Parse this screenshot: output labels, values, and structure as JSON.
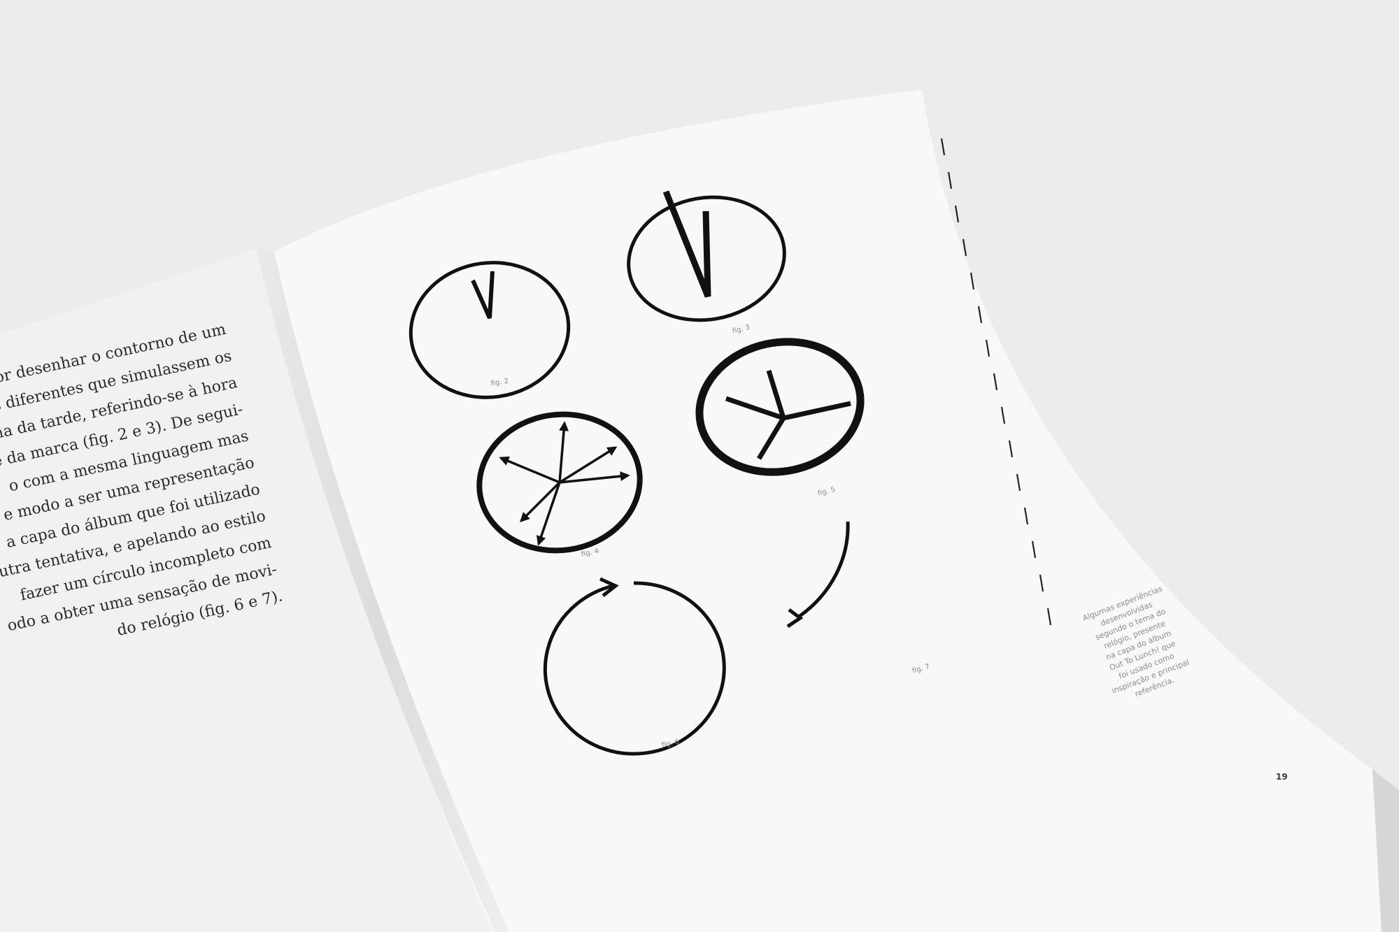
{
  "body_text": {
    "lines": [
      "or desenhar o contorno de um",
      "s diferentes que simulassem os",
      "ma da tarde, referindo-se à hora",
      "me da marca (fig. 2 e 3). De segui-",
      "o com a mesma linguagem mas",
      "e modo a ser uma representação",
      "a capa do álbum que foi utilizado",
      "utra tentativa, e apelando ao estilo",
      "fazer um círculo incompleto com",
      "odo a obter uma sensação de movi-",
      "do relógio (fig. 6 e 7)."
    ]
  },
  "figures": {
    "fig2": "fig. 2",
    "fig3": "fig. 3",
    "fig4": "fig. 4",
    "fig5": "fig. 5",
    "fig6": "fig. 6",
    "fig7": "fig. 7"
  },
  "caption": {
    "lines": [
      "Algumas experiências",
      "desenvolvidas",
      "segundo o tema do",
      "relógio, presente",
      "na capa do álbum",
      "Out To Lunch! que",
      "foi usado como",
      "inspiração e principal",
      "referência."
    ]
  },
  "page_number": "19",
  "colors": {
    "ink": "#111111",
    "paper": "#f7f7f7",
    "background": "#ececec",
    "caption_gray": "#8a8a8a"
  }
}
